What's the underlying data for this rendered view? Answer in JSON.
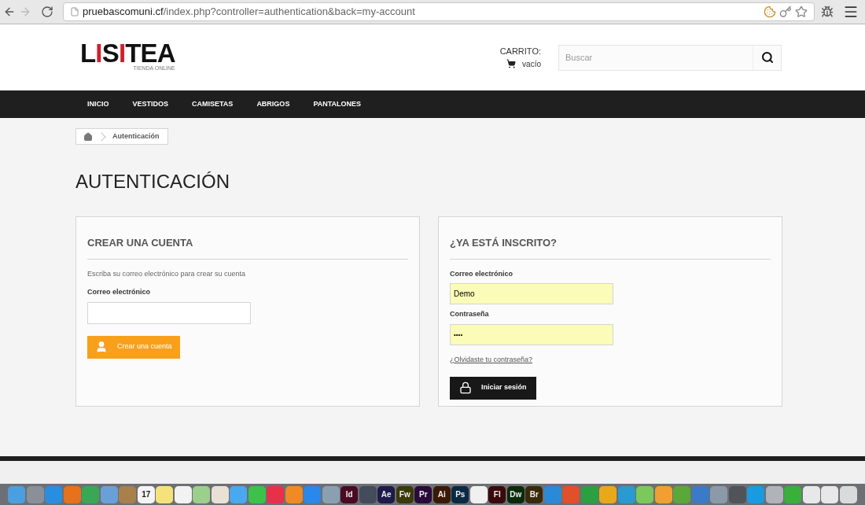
{
  "browser": {
    "url_host": "pruebascomuni.cf",
    "url_path": "/index.php?controller=authentication&back=my-account"
  },
  "header": {
    "logo": {
      "parts": [
        {
          "text": "L",
          "accent": false
        },
        {
          "text": "I",
          "accent": true
        },
        {
          "text": "S",
          "accent": false
        },
        {
          "text": "I",
          "accent": true
        },
        {
          "text": "TEA",
          "accent": false
        }
      ],
      "tagline": "TIENDA ONLINE"
    },
    "cart": {
      "label": "CARRITO:",
      "status": "vacío"
    },
    "search": {
      "placeholder": "Buscar"
    }
  },
  "nav": [
    "INICIO",
    "VESTIDOS",
    "CAMISETAS",
    "ABRIGOS",
    "PANTALONES"
  ],
  "breadcrumb": {
    "current": "Autenticación"
  },
  "page_title": "AUTENTICACIÓN",
  "create_account": {
    "title": "CREAR UNA CUENTA",
    "intro": "Escriba su correo electrónico para crear su cuenta",
    "email_label": "Correo electrónico",
    "button": "Crear una cuenta"
  },
  "login": {
    "title": "¿YA ESTÁ INSCRITO?",
    "email_label": "Correo electrónico",
    "email_value": "Demo",
    "password_label": "Contraseña",
    "password_value": "••••",
    "forgot": "¿Olvidaste tu contraseña?",
    "button": "Iniciar sesión"
  },
  "dock": [
    {
      "color": "#4a9fe0"
    },
    {
      "color": "#8a8f98"
    },
    {
      "color": "#2a8ee0"
    },
    {
      "color": "#e8711c"
    },
    {
      "color": "#3aa757"
    },
    {
      "color": "#6aa0d8"
    },
    {
      "color": "#a8804c"
    },
    {
      "color": "#f4f4f4",
      "label": "17"
    },
    {
      "color": "#f6e27a"
    },
    {
      "color": "#f2f2f2"
    },
    {
      "color": "#9ccf8c"
    },
    {
      "color": "#e9e1d6"
    },
    {
      "color": "#48a8f0"
    },
    {
      "color": "#3cc24a"
    },
    {
      "color": "#e8304a"
    },
    {
      "color": "#f08a24"
    },
    {
      "color": "#2a88e8"
    },
    {
      "color": "#8aa0b0"
    },
    {
      "color": "#4a0a22",
      "label": "Id"
    },
    {
      "color": "#444b5a"
    },
    {
      "color": "#1e1a4a",
      "label": "Ae"
    },
    {
      "color": "#3a3a0a",
      "label": "Fw"
    },
    {
      "color": "#2a0a3a",
      "label": "Pr"
    },
    {
      "color": "#3a1a04",
      "label": "Ai"
    },
    {
      "color": "#0a2a44",
      "label": "Ps"
    },
    {
      "color": "#f0f0f0"
    },
    {
      "color": "#3a0a0a",
      "label": "Fl"
    },
    {
      "color": "#0a2a0a",
      "label": "Dw"
    },
    {
      "color": "#3a2a0a",
      "label": "Br"
    },
    {
      "color": "#2a8ad8"
    },
    {
      "color": "#e0502a"
    },
    {
      "color": "#2aa040"
    },
    {
      "color": "#e8a81a"
    },
    {
      "color": "#2a9ad0"
    },
    {
      "color": "#7cc85a"
    },
    {
      "color": "#f0a030"
    },
    {
      "color": "#5aa83a"
    },
    {
      "color": "#3a7ac8"
    },
    {
      "color": "#8a9aa8"
    },
    {
      "color": "#505458"
    },
    {
      "color": "#1a9ae0"
    },
    {
      "color": "#b0b4b8"
    },
    {
      "color": "#3ab03a"
    },
    {
      "color": "#e8e8e8"
    },
    {
      "color": "#e8e8e8"
    },
    {
      "color": "#d8dadc"
    }
  ]
}
